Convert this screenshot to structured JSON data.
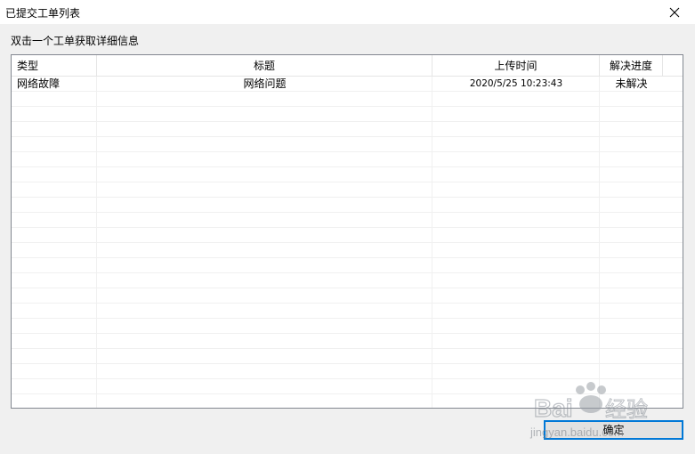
{
  "window": {
    "title": "已提交工单列表",
    "close_icon": "close-icon"
  },
  "hint": "双击一个工单获取详细信息",
  "table": {
    "columns": [
      "类型",
      "标题",
      "上传时间",
      "解决进度"
    ],
    "rows": [
      [
        "网络故障",
        "网络问题",
        "2020/5/25 10:23:43",
        "未解决"
      ]
    ]
  },
  "ok_button": "确定",
  "watermark": {
    "logo_text": "Baidu经验",
    "url": "jingyan.baidu.com"
  },
  "colors": {
    "accent": "#0078d7",
    "window_bg": "#f0f0f0",
    "grid_line": "#f0f0f0"
  }
}
